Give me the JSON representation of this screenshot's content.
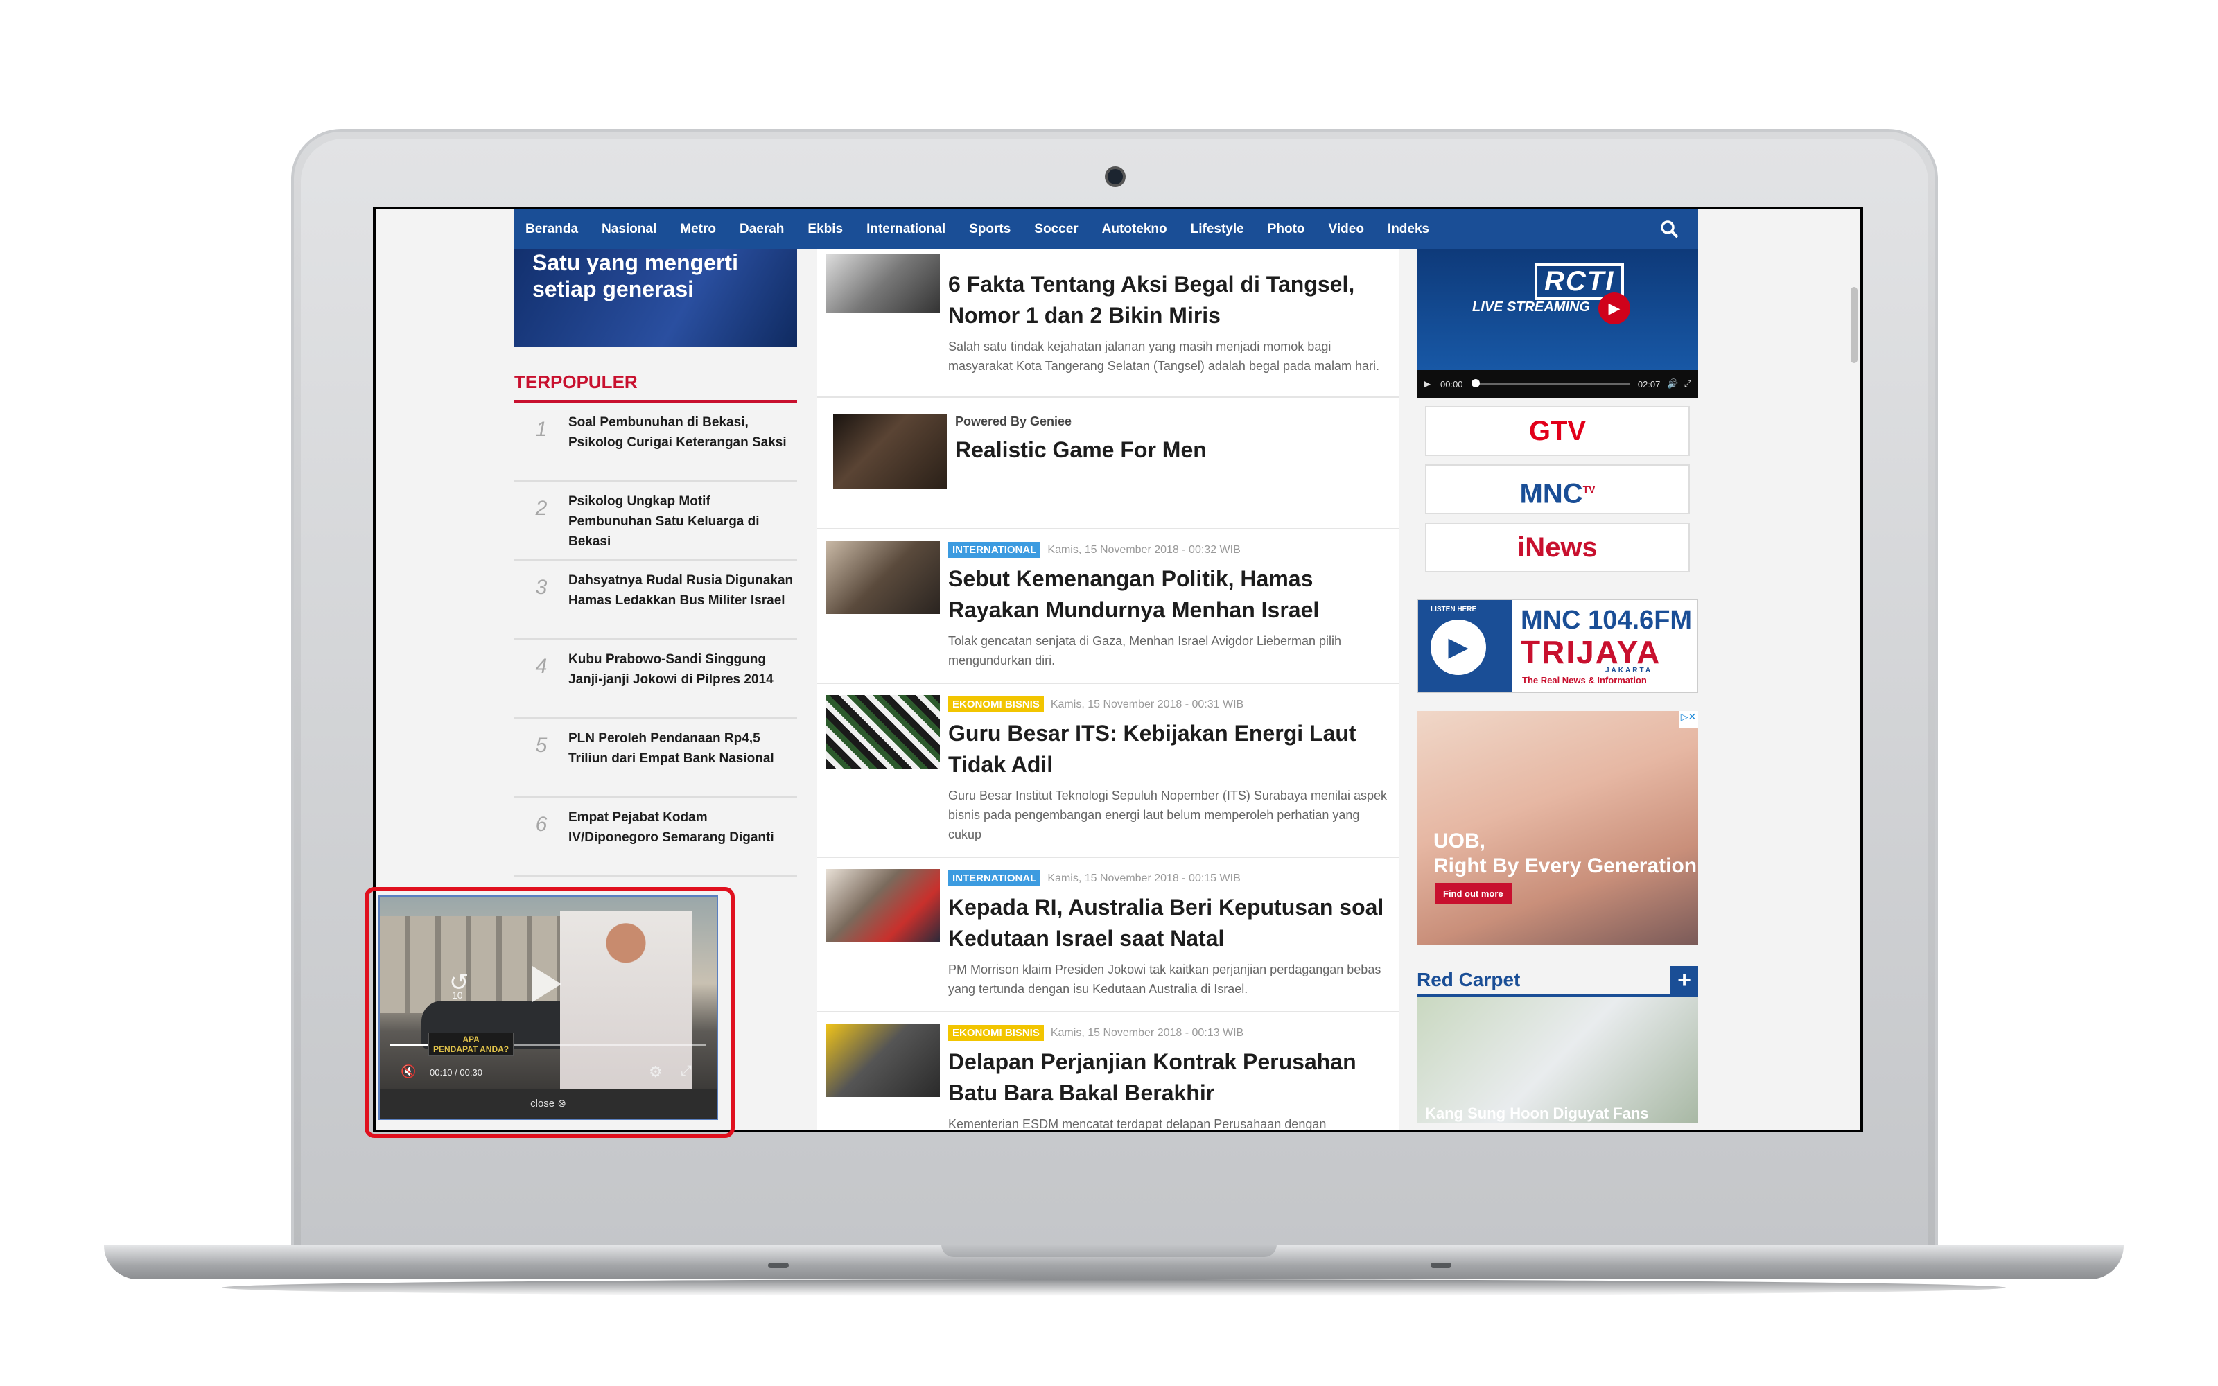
{
  "nav": {
    "items": [
      "Beranda",
      "Nasional",
      "Metro",
      "Daerah",
      "Ekbis",
      "International",
      "Sports",
      "Soccer",
      "Autotekno",
      "Lifestyle",
      "Photo",
      "Video",
      "Indeks"
    ],
    "search_icon": "search-icon"
  },
  "banner": {
    "text": "Satu yang mengerti setiap generasi"
  },
  "terpopuler": {
    "title": "TERPOPULER",
    "items": [
      {
        "num": "1",
        "text": "Soal Pembunuhan di Bekasi, Psikolog Curigai Keterangan Saksi"
      },
      {
        "num": "2",
        "text": "Psikolog Ungkap Motif Pembunuhan Satu Keluarga di Bekasi"
      },
      {
        "num": "3",
        "text": "Dahsyatnya Rudal Rusia Digunakan Hamas Ledakkan Bus Militer Israel"
      },
      {
        "num": "4",
        "text": "Kubu Prabowo-Sandi Singgung Janji-janji Jokowi di Pilpres 2014"
      },
      {
        "num": "5",
        "text": "PLN Peroleh Pendanaan Rp4,5 Triliun dari Empat Bank Nasional"
      },
      {
        "num": "6",
        "text": "Empat Pejabat Kodam IV/Diponegoro Semarang Diganti"
      }
    ]
  },
  "articles": [
    {
      "title": "6 Fakta Tentang Aksi Begal di Tangsel, Nomor 1 dan 2 Bikin Miris",
      "summary": "Salah satu tindak kejahatan jalanan yang masih menjadi momok bagi masyarakat Kota Tangerang Selatan (Tangsel) adalah begal pada malam hari."
    },
    {
      "badge": "INTERNATIONAL",
      "badge_color": "#3c9be0",
      "meta": "Kamis, 15 November 2018 - 00:32 WIB",
      "title": "Sebut Kemenangan Politik, Hamas Rayakan Mundurnya Menhan Israel",
      "summary": "Tolak gencatan senjata di Gaza, Menhan Israel Avigdor Lieberman pilih mengundurkan diri."
    },
    {
      "badge": "EKONOMI BISNIS",
      "badge_color": "#f2c500",
      "meta": "Kamis, 15 November 2018 - 00:31 WIB",
      "title": "Guru Besar ITS: Kebijakan Energi Laut Tidak Adil",
      "summary": "Guru Besar Institut Teknologi Sepuluh Nopember (ITS) Surabaya menilai aspek bisnis pada pengembangan energi laut belum memperoleh perhatian yang cukup"
    },
    {
      "badge": "INTERNATIONAL",
      "badge_color": "#3c9be0",
      "meta": "Kamis, 15 November 2018 - 00:15 WIB",
      "title": "Kepada RI, Australia Beri Keputusan soal Kedutaan Israel saat Natal",
      "summary": "PM Morrison klaim Presiden Jokowi tak kaitkan perjanjian perdagangan bebas yang tertunda dengan isu Kedutaan Australia di Israel."
    },
    {
      "badge": "EKONOMI BISNIS",
      "badge_color": "#f2c500",
      "meta": "Kamis, 15 November 2018 - 00:13 WIB",
      "title": "Delapan Perjanjian Kontrak Perusahan Batu Bara Bakal Berakhir",
      "summary": "Kementerian ESDM mencatat terdapat delapan Perusahaan dengan"
    }
  ],
  "promo": {
    "by": "Powered By Geniee",
    "title": "Realistic Game For Men"
  },
  "rcti": {
    "logo": "RCTI",
    "live": "LIVE STREAMING",
    "time_current": "00:00",
    "time_total": "02:07",
    "progress": 0
  },
  "channels": [
    {
      "name": "GTV",
      "color": "#e2001a"
    },
    {
      "name": "MNC",
      "sup": "TV",
      "color": "#1a4e96"
    },
    {
      "name": "iNews",
      "color": "#c8102e"
    }
  ],
  "radio": {
    "listen": "LISTEN HERE",
    "station": "MNC 104.6FM",
    "name": "TRIJAYA",
    "city": "JAKARTA",
    "tagline": "The Real News & Information"
  },
  "uob_ad": {
    "line1": "UOB,",
    "line2": "Right By Every Generation",
    "button": "Find out more"
  },
  "red_carpet": {
    "title": "Red Carpet",
    "plus": "+",
    "caption": "Kang Sung Hoon Diguyat Fans"
  },
  "player": {
    "label_line1": "APA",
    "label_line2": "PENDAPAT ANDA?",
    "time_current": "00:10",
    "time_total": "00:30",
    "rewind": "10",
    "close_label": "close",
    "progress": 0.33
  }
}
